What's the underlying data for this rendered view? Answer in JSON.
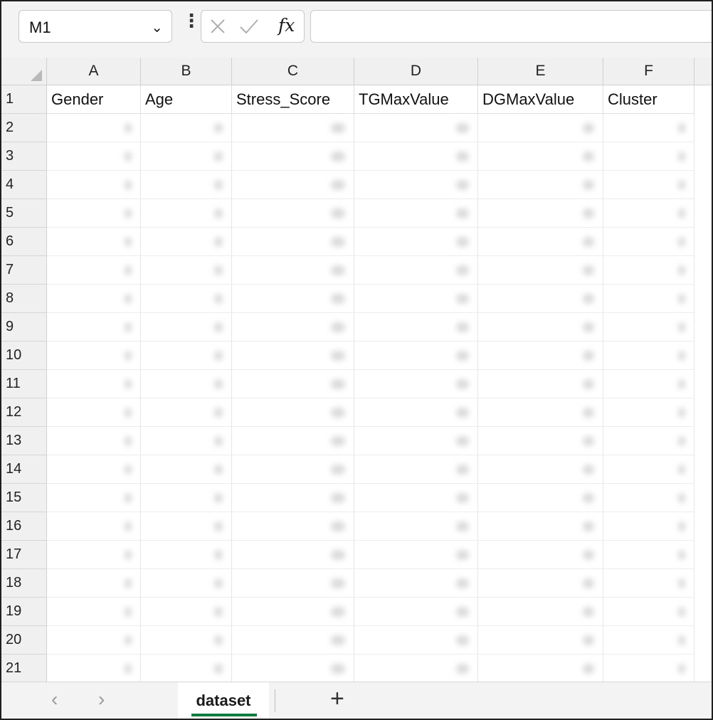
{
  "formula_bar": {
    "name_box": "M1",
    "formula_value": ""
  },
  "columns": [
    "A",
    "B",
    "C",
    "D",
    "E",
    "F"
  ],
  "header_row": [
    "Gender",
    "Age",
    "Stress_Score",
    "TGMaxValue",
    "DGMaxValue",
    "Cluster"
  ],
  "row_numbers": [
    "1",
    "2",
    "3",
    "4",
    "5",
    "6",
    "7",
    "8",
    "9",
    "10",
    "11",
    "12",
    "13",
    "14",
    "15",
    "16",
    "17",
    "18",
    "19",
    "20",
    "21"
  ],
  "sheet_tabs": {
    "active": "dataset",
    "add_label": "+"
  },
  "icons": {
    "name_box_caret": "chevron-down-icon",
    "cancel": "x-icon",
    "enter": "check-icon",
    "function": "fx-icon",
    "prev_sheet": "chevron-left-icon",
    "next_sheet": "chevron-right-icon"
  },
  "colors": {
    "accent_sheet_tab": "#107c41",
    "header_bg": "#f0f0f0"
  }
}
